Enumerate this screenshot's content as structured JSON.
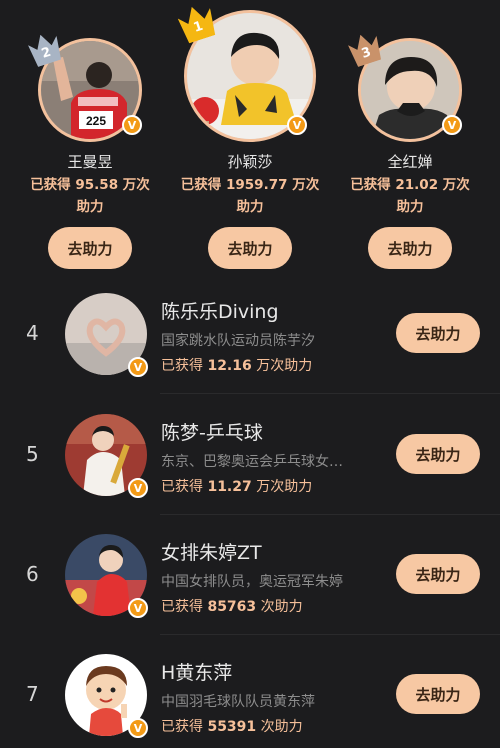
{
  "top3": [
    {
      "rank": "2",
      "name": "王曼昱",
      "stat_prefix": "已获得",
      "stat_value": "95.58",
      "stat_unit": "万次",
      "stat_suffix": "助力",
      "button": "去助力",
      "crown_color": "#a8b4c4",
      "jersey": "225"
    },
    {
      "rank": "1",
      "name": "孙颖莎",
      "stat_prefix": "已获得",
      "stat_value": "1959.77",
      "stat_unit": "万次",
      "stat_suffix": "助力",
      "button": "去助力",
      "crown_color": "#f5b712"
    },
    {
      "rank": "3",
      "name": "全红婵",
      "stat_prefix": "已获得",
      "stat_value": "21.02",
      "stat_unit": "万次",
      "stat_suffix": "助力",
      "button": "去助力",
      "crown_color": "#c9926a"
    }
  ],
  "list": [
    {
      "rank": "4",
      "name": "陈乐乐Diving",
      "desc": "国家跳水队运动员陈芋汐",
      "stat_prefix": "已获得",
      "stat_value": "12.16",
      "stat_unit": "万次助力",
      "button": "去助力"
    },
    {
      "rank": "5",
      "name": "陈梦-乒乓球",
      "desc": "东京、巴黎奥运会乒乓球女…",
      "stat_prefix": "已获得",
      "stat_value": "11.27",
      "stat_unit": "万次助力",
      "button": "去助力"
    },
    {
      "rank": "6",
      "name": "女排朱婷ZT",
      "desc": "中国女排队员，奥运冠军朱婷",
      "stat_prefix": "已获得",
      "stat_value": "85763",
      "stat_unit": "次助力",
      "button": "去助力"
    },
    {
      "rank": "7",
      "name": "H黄东萍",
      "desc": "中国羽毛球队队员黄东萍",
      "stat_prefix": "已获得",
      "stat_value": "55391",
      "stat_unit": "次助力",
      "button": "去助力"
    }
  ],
  "verified_mark": "V",
  "colors": {
    "background": "#1c1c1e",
    "accent": "#f6c09a",
    "button_bg": "#f7c8a3",
    "badge": "#f39a16"
  }
}
